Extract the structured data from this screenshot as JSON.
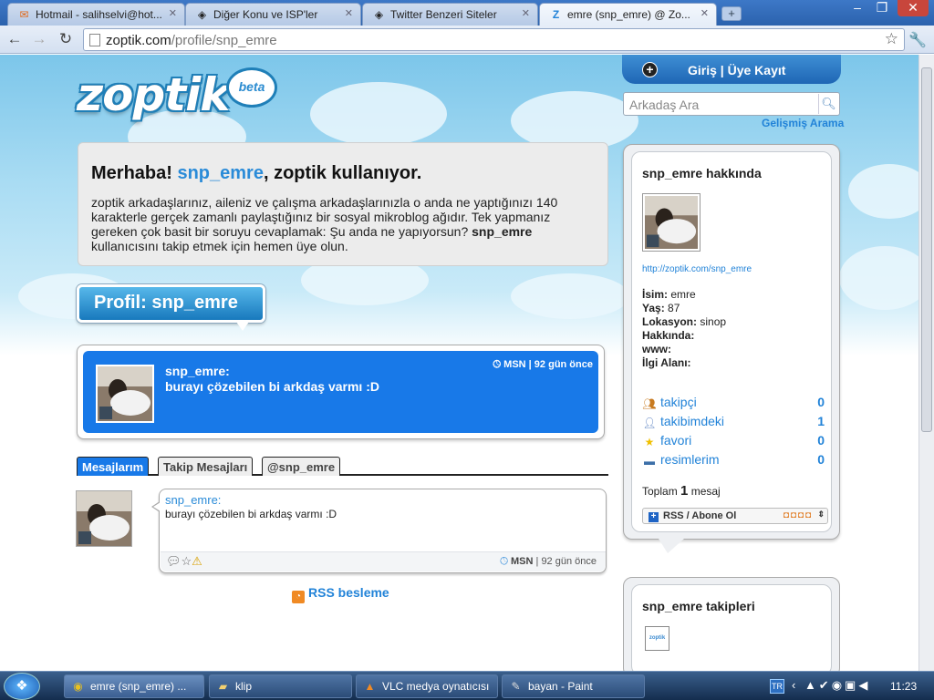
{
  "browser": {
    "tabs": [
      {
        "title": "Hotmail - salihselvi@hot...",
        "icon": "hotmail-icon"
      },
      {
        "title": "Diğer Konu ve ISP'ler",
        "icon": "forum-icon"
      },
      {
        "title": "Twitter Benzeri Siteler",
        "icon": "forum-icon"
      },
      {
        "title": "emre (snp_emre) @ Zo...",
        "icon": "zoptik-icon"
      }
    ],
    "new_tab": "+",
    "url_host": "zoptik.com",
    "url_path": "/profile/snp_emre",
    "window_controls": {
      "minimize": "–",
      "maximize": "❐",
      "close": "✕"
    }
  },
  "site": {
    "logo": "zoptik",
    "beta": "beta",
    "login": "Giriş | Üye Kayıt",
    "search_placeholder": "Arkadaş Ara",
    "advanced_search": "Gelişmiş Arama"
  },
  "welcome": {
    "greeting": "Merhaba! ",
    "username": "snp_emre",
    "greeting_rest": ", zoptik kullanıyor.",
    "body_1": "zoptik arkadaşlarınız, aileniz ve çalışma arkadaşlarınızla o anda ne yaptığınızı 140 karakterle gerçek zamanlı paylaştığınız bir sosyal mikroblog ağıdır. Tek yapmanız gereken çok basit bir soruyu cevaplamak: Şu anda ne yapıyorsun? ",
    "body_user": "snp_emre",
    "body_2": " kullanıcısını takip etmek için hemen üye olun."
  },
  "profile_header": "Profil: snp_emre",
  "latest": {
    "user": "snp_emre:",
    "text": "burayı çözebilen bi arkdaş varmı :D",
    "meta": "MSN | 92 gün önce"
  },
  "tabs": [
    "Mesajlarım",
    "Takip Mesajları",
    "@snp_emre"
  ],
  "message": {
    "user": "snp_emre:",
    "text": "burayı çözebilen bi arkdaş varmı :D",
    "source": "MSN",
    "time": " | 92 gün önce"
  },
  "rss_feed": "RSS besleme",
  "sidebar": {
    "about_title": "snp_emre hakkında",
    "profile_link": "http://zoptik.com/snp_emre",
    "info": [
      {
        "label": "İsim:",
        "value": " emre"
      },
      {
        "label": "Yaş:",
        "value": " 87"
      },
      {
        "label": "Lokasyon:",
        "value": " sinop"
      },
      {
        "label": "Hakkında:",
        "value": ""
      },
      {
        "label": "www:",
        "value": ""
      },
      {
        "label": "İlgi Alanı:",
        "value": ""
      }
    ],
    "stats": [
      {
        "label": "takipçi",
        "count": "0"
      },
      {
        "label": "takibimdeki",
        "count": "1"
      },
      {
        "label": "favori",
        "count": "0"
      },
      {
        "label": "resimlerim",
        "count": "0"
      }
    ],
    "total_prefix": "Toplam ",
    "total_count": "1",
    "total_suffix": " mesaj",
    "rss_button": "RSS / Abone Ol",
    "followers_title": "snp_emre takipleri",
    "follower_thumb_text": "zoptik"
  },
  "taskbar": {
    "start": "❖",
    "tasks": [
      {
        "label": "emre (snp_emre) ...",
        "icon": "chrome-icon"
      },
      {
        "label": "klip",
        "icon": "folder-icon"
      },
      {
        "label": "VLC medya oynatıcısı",
        "icon": "vlc-icon"
      },
      {
        "label": "bayan - Paint",
        "icon": "paint-icon"
      }
    ],
    "lang": "TR",
    "clock": "11:23"
  }
}
